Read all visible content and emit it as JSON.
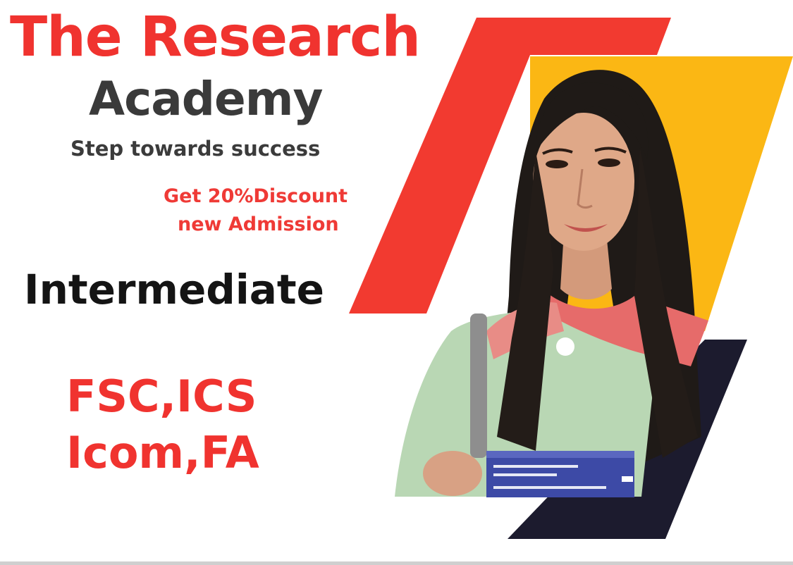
{
  "banner": {
    "title_line1": "The Research",
    "title_line2": "Academy",
    "tagline": "Step towards success",
    "promo_line1": "Get 20%Discount",
    "promo_line2": "new Admission",
    "level": "Intermediate",
    "programs_line1": "FSC,ICS",
    "programs_line2": "Icom,FA"
  },
  "colors": {
    "red": "#f0332f",
    "yellow": "#fbb714",
    "navy": "#1c1b2e",
    "dark_text": "#3a3a3a",
    "black_text": "#141414"
  },
  "image": {
    "subject": "student-photo",
    "description_icon": "student-with-books-icon"
  }
}
